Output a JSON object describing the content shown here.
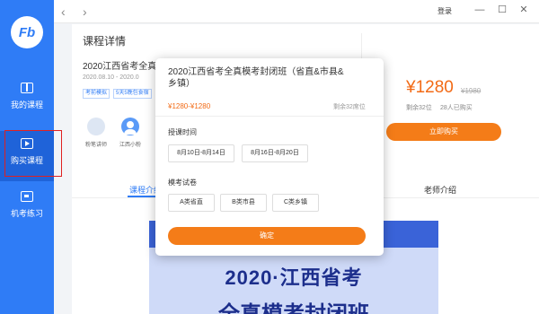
{
  "app": {
    "logo": "Fb"
  },
  "sidebar": {
    "items": [
      {
        "label": "我的课程",
        "icon": "book-icon"
      },
      {
        "label": "购买课程",
        "icon": "play-icon"
      },
      {
        "label": "机考练习",
        "icon": "desk-icon"
      }
    ]
  },
  "topbar": {
    "back": "‹",
    "forward": "›",
    "login": "登录",
    "minimize": "—",
    "maximize": "☐",
    "close": "✕"
  },
  "course": {
    "section_title": "课程详情",
    "name": "2020江西省考全真",
    "date": "2020.08.10 - 2020.0",
    "tags": [
      "考前模拟",
      "5天5晚包食宿"
    ],
    "teachers": [
      {
        "name": "粉笔讲师"
      },
      {
        "name": "江西小粉"
      }
    ],
    "price": "¥1280",
    "old_price": "¥1980",
    "remaining": "剩余32位",
    "bought": "28人已购买",
    "buy_label": "立即购买"
  },
  "tabs": [
    "课程介绍",
    "老师介绍"
  ],
  "banner": {
    "line1": "2020·江西省考",
    "line2": "全真模考封闭班"
  },
  "popup": {
    "title": "2020江西省考全真模考封闭班（省直&市县&乡镇）",
    "price_range": "¥1280-¥1280",
    "remaining": "剩余32席位",
    "time_label": "授课时间",
    "time_options": [
      "8月10日-8月14日",
      "8月16日-8月20日"
    ],
    "exam_label": "模考试卷",
    "exam_options": [
      "A类省直",
      "B类市县",
      "C类乡镇"
    ],
    "confirm_label": "确定"
  },
  "colors": {
    "accent": "#2f7cf6",
    "orange": "#f47c18",
    "highlight": "#e02020"
  }
}
